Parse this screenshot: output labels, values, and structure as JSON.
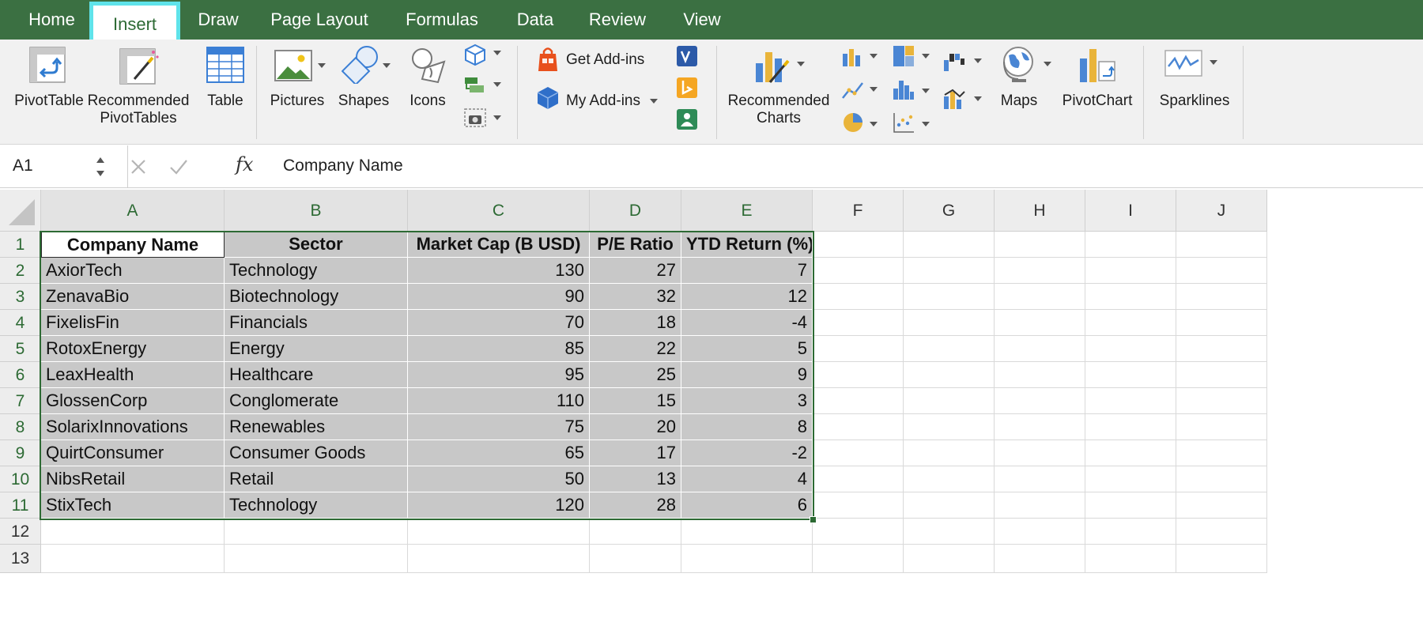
{
  "tabs": [
    {
      "label": "Home",
      "active": false
    },
    {
      "label": "Insert",
      "active": true
    },
    {
      "label": "Draw",
      "active": false
    },
    {
      "label": "Page Layout",
      "active": false
    },
    {
      "label": "Formulas",
      "active": false
    },
    {
      "label": "Data",
      "active": false
    },
    {
      "label": "Review",
      "active": false
    },
    {
      "label": "View",
      "active": false
    }
  ],
  "ribbon": {
    "pivottable": "PivotTable",
    "recommended_pivottables_1": "Recommended",
    "recommended_pivottables_2": "PivotTables",
    "table": "Table",
    "pictures": "Pictures",
    "shapes": "Shapes",
    "icons": "Icons",
    "get_addins": "Get Add-ins",
    "my_addins": "My Add-ins",
    "recommended_charts_1": "Recommended",
    "recommended_charts_2": "Charts",
    "maps": "Maps",
    "pivotchart": "PivotChart",
    "sparklines": "Sparklines"
  },
  "formula_bar": {
    "name_box": "A1",
    "fx": "fx",
    "content": "Company Name"
  },
  "columns": [
    "A",
    "B",
    "C",
    "D",
    "E",
    "F",
    "G",
    "H",
    "I",
    "J"
  ],
  "rows": [
    "1",
    "2",
    "3",
    "4",
    "5",
    "6",
    "7",
    "8",
    "9",
    "10",
    "11",
    "12",
    "13"
  ],
  "table": {
    "headers": [
      "Company Name",
      "Sector",
      "Market Cap (B USD)",
      "P/E Ratio",
      "YTD Return (%)"
    ],
    "rows": [
      [
        "AxiorTech",
        "Technology",
        "130",
        "27",
        "7"
      ],
      [
        "ZenavaBio",
        "Biotechnology",
        "90",
        "32",
        "12"
      ],
      [
        "FixelisFin",
        "Financials",
        "70",
        "18",
        "-4"
      ],
      [
        "RotoxEnergy",
        "Energy",
        "85",
        "22",
        "5"
      ],
      [
        "LeaxHealth",
        "Healthcare",
        "95",
        "25",
        "9"
      ],
      [
        "GlossenCorp",
        "Conglomerate",
        "110",
        "15",
        "3"
      ],
      [
        "SolarixInnovations",
        "Renewables",
        "75",
        "20",
        "8"
      ],
      [
        "QuirtConsumer",
        "Consumer Goods",
        "65",
        "17",
        "-2"
      ],
      [
        "NibsRetail",
        "Retail",
        "50",
        "13",
        "4"
      ],
      [
        "StixTech",
        "Technology",
        "120",
        "28",
        "6"
      ]
    ]
  },
  "colors": {
    "tab_bar": "#3b7042",
    "accent_green": "#2d6a34",
    "active_tab_outline": "#5fe3ea",
    "selection_fill": "#c8c8c8"
  }
}
